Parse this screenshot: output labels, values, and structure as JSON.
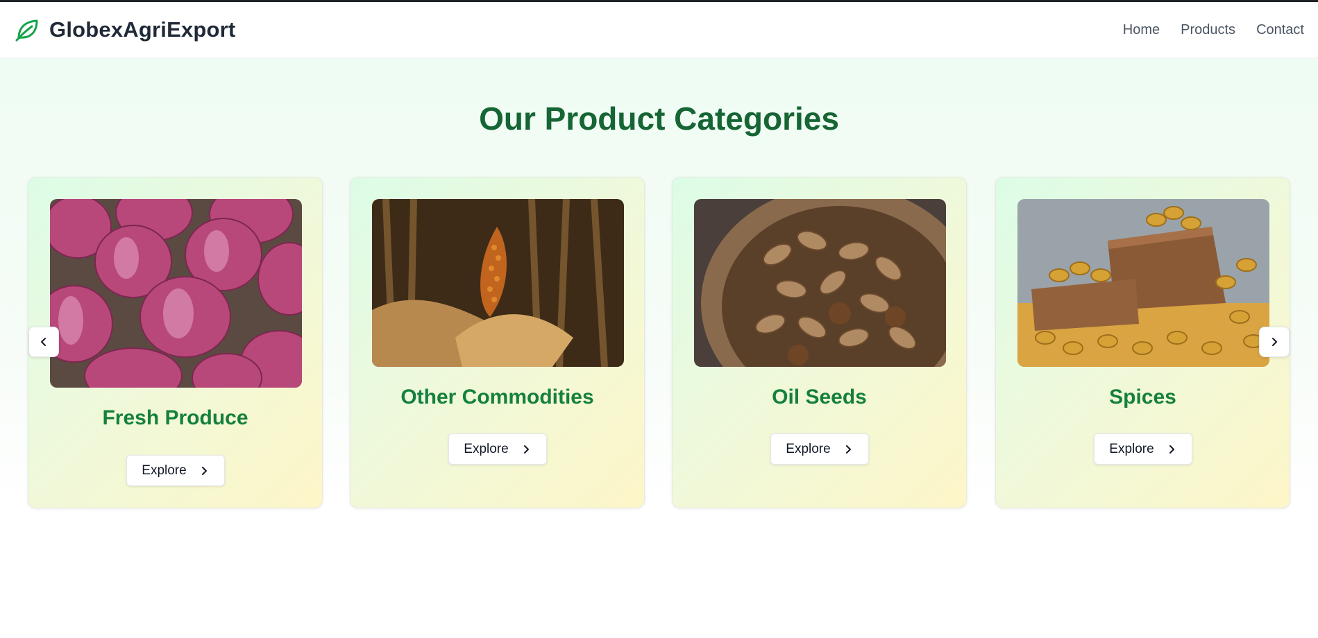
{
  "header": {
    "brand_name": "GlobexAgriExport",
    "brand_icon": "leaf-icon",
    "nav": [
      "Home",
      "Products",
      "Contact"
    ]
  },
  "main": {
    "title": "Our Product Categories",
    "carousel": {
      "prev_icon": "chevron-left-icon",
      "next_icon": "chevron-right-icon",
      "cards": [
        {
          "title": "Fresh Produce",
          "button": "Explore",
          "image": "red-onions-photo"
        },
        {
          "title": "Other Commodities",
          "button": "Explore",
          "image": "corn-cob-photo"
        },
        {
          "title": "Oil Seeds",
          "button": "Explore",
          "image": "peanuts-bowl-photo"
        },
        {
          "title": "Spices",
          "button": "Explore",
          "image": "turmeric-roots-photo"
        }
      ]
    }
  },
  "colors": {
    "brand_green": "#166534",
    "card_title_green": "#15803d",
    "text_dark": "#1f2937",
    "nav_gray": "#4b5563"
  }
}
